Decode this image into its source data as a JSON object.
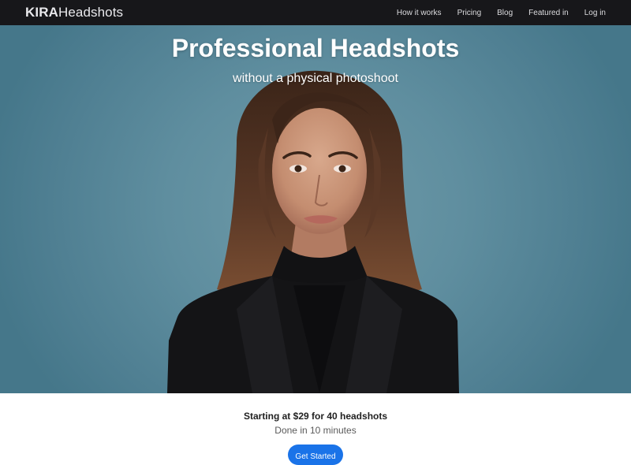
{
  "header": {
    "brand_bold": "KIRA",
    "brand_rest": "Headshots",
    "nav": [
      {
        "label": "How it works"
      },
      {
        "label": "Pricing"
      },
      {
        "label": "Blog"
      },
      {
        "label": "Featured in"
      },
      {
        "label": "Log in"
      }
    ]
  },
  "hero": {
    "title": "Professional Headshots",
    "subtitle": "without a physical photoshoot"
  },
  "offer": {
    "price_line": "Starting at $29 for 40 headshots",
    "eta_line": "Done in 10 minutes",
    "cta_label": "Get Started"
  },
  "colors": {
    "navbar_bg": "#17171a",
    "hero_bg": "#5f8e9f",
    "cta_bg": "#1a73e8"
  }
}
